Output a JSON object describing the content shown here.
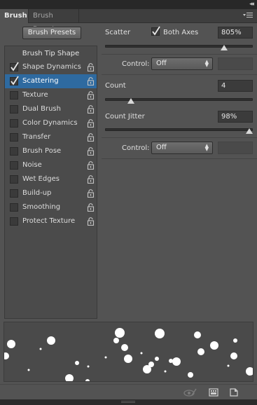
{
  "window": {
    "collapse_glyph": "◂◂",
    "close_glyph": "✕"
  },
  "tabs": [
    {
      "label": "Brush",
      "active": true
    },
    {
      "label": "Brush Presets",
      "active": false
    }
  ],
  "panel_menu_icon": "panel-menu-icon",
  "brush_presets_button": "Brush Presets",
  "brush_tip_shape": "Brush Tip Shape",
  "options": [
    {
      "label": "Shape Dynamics",
      "checked": true,
      "selected": false
    },
    {
      "label": "Scattering",
      "checked": true,
      "selected": true
    },
    {
      "label": "Texture",
      "checked": false,
      "selected": false
    },
    {
      "label": "Dual Brush",
      "checked": false,
      "selected": false
    },
    {
      "label": "Color Dynamics",
      "checked": false,
      "selected": false
    },
    {
      "label": "Transfer",
      "checked": false,
      "selected": false
    },
    {
      "label": "Brush Pose",
      "checked": false,
      "selected": false
    },
    {
      "label": "Noise",
      "checked": false,
      "selected": false
    },
    {
      "label": "Wet Edges",
      "checked": false,
      "selected": false
    },
    {
      "label": "Build-up",
      "checked": false,
      "selected": false
    },
    {
      "label": "Smoothing",
      "checked": false,
      "selected": false
    },
    {
      "label": "Protect Texture",
      "checked": false,
      "selected": false
    }
  ],
  "scatter": {
    "label": "Scatter",
    "both_axes_label": "Both Axes",
    "both_axes_checked": true,
    "value": "805%",
    "slider_fraction": 0.81,
    "control_label": "Control:",
    "control_value": "Off"
  },
  "count": {
    "label": "Count",
    "value": "4",
    "slider_fraction": 0.17
  },
  "count_jitter": {
    "label": "Count Jitter",
    "value": "98%",
    "slider_fraction": 0.98,
    "control_label": "Control:",
    "control_value": "Off"
  },
  "bottom_icons": [
    "toggle-live-tip-icon",
    "create-new-brush-icon",
    "new-preset-icon"
  ],
  "colors": {
    "panel_bg": "#535353",
    "selection": "#2e6aa0",
    "field_bg": "#3b3b3b"
  }
}
